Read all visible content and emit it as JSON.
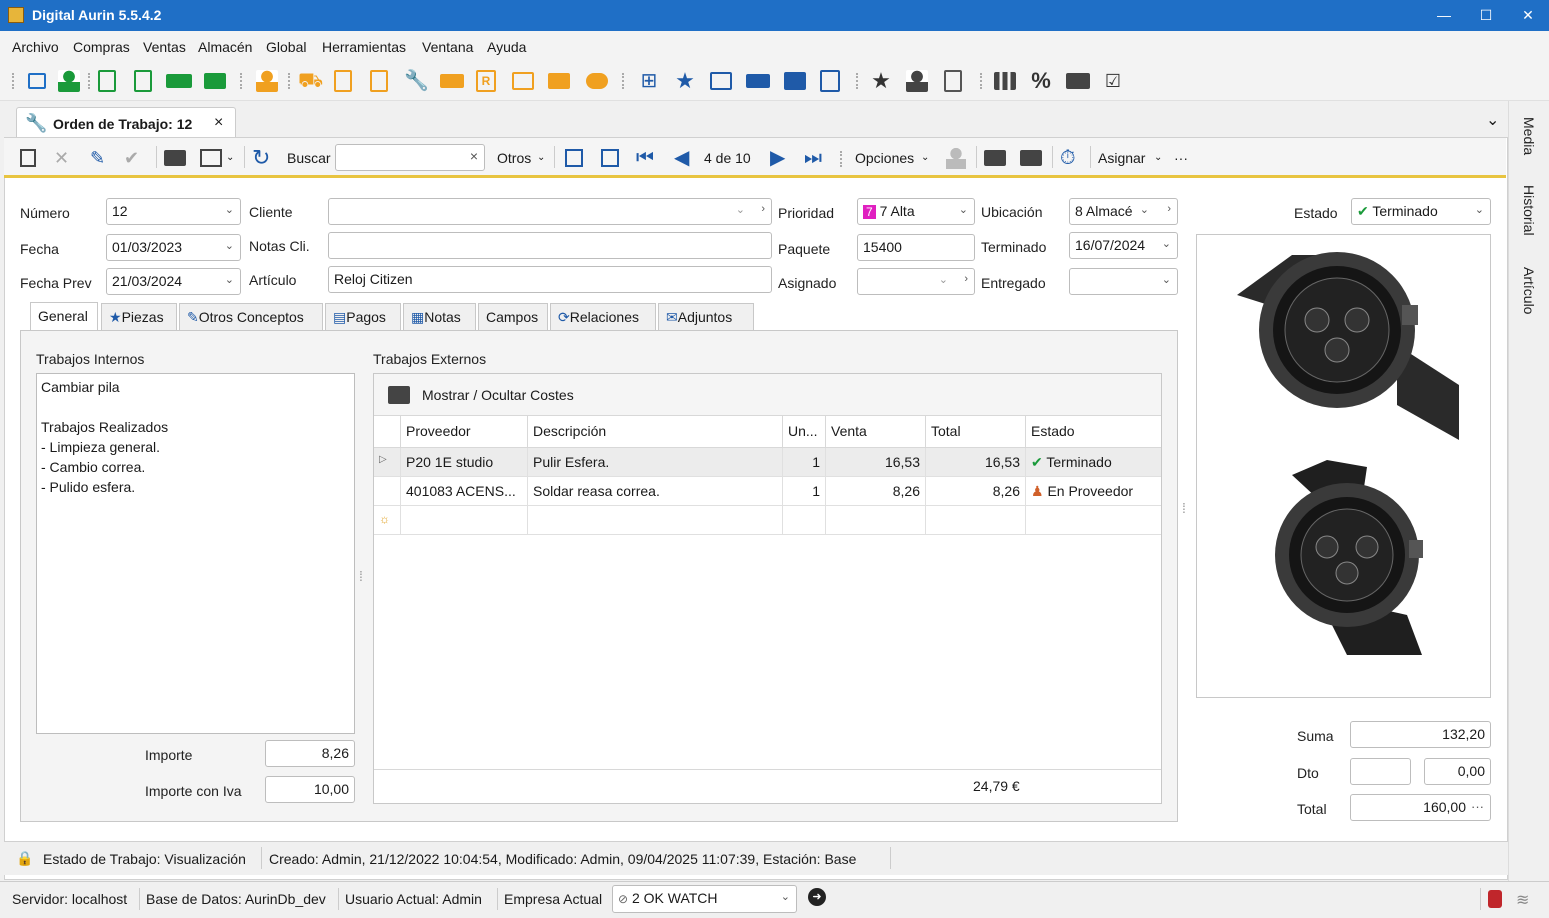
{
  "window": {
    "title": "Digital Aurin 5.5.4.2",
    "min": "—",
    "max": "☐",
    "close": "✕"
  },
  "menu": [
    "Archivo",
    "Compras",
    "Ventas",
    "Almacén",
    "Global",
    "Herramientas",
    "Ventana",
    "Ayuda"
  ],
  "doc_tab": {
    "label": "Orden de Trabajo: 12",
    "close": "×",
    "overflow": "⌄"
  },
  "side_tabs": [
    "Media",
    "Historial",
    "Artículo"
  ],
  "toolbar": {
    "buscar": "Buscar",
    "otros": "Otros",
    "pager": "4 de 10",
    "opciones": "Opciones",
    "asignar": "Asignar",
    "more": "···",
    "clear": "×"
  },
  "form": {
    "numero": {
      "label": "Número",
      "value": "12"
    },
    "fecha": {
      "label": "Fecha",
      "value": "01/03/2023"
    },
    "fecha_prev": {
      "label": "Fecha Prev",
      "value": "21/03/2024"
    },
    "cliente": {
      "label": "Cliente",
      "value": ""
    },
    "notas_cli": {
      "label": "Notas Cli.",
      "value": ""
    },
    "articulo": {
      "label": "Artículo",
      "value": "Reloj Citizen"
    },
    "prioridad": {
      "label": "Prioridad",
      "value": "7 Alta",
      "badge": "7",
      "badge_color": "#e020c0"
    },
    "paquete": {
      "label": "Paquete",
      "value": "15400"
    },
    "asignado": {
      "label": "Asignado",
      "value": ""
    },
    "ubicacion": {
      "label": "Ubicación",
      "value": "8 Almacé"
    },
    "terminado": {
      "label": "Terminado",
      "value": "16/07/2024"
    },
    "entregado": {
      "label": "Entregado",
      "value": ""
    },
    "estado": {
      "label": "Estado",
      "value": "Terminado"
    }
  },
  "inner_tabs": [
    "General",
    "Piezas",
    "Otros Conceptos",
    "Pagos",
    "Notas",
    "Campos",
    "Relaciones",
    "Adjuntos"
  ],
  "trabajos_internos": {
    "label": "Trabajos Internos",
    "text": "Cambiar pila\n\nTrabajos Realizados\n- Limpieza general.\n- Cambio correa.\n- Pulido esfera."
  },
  "importe": {
    "label": "Importe",
    "value": "8,26"
  },
  "importe_iva": {
    "label": "Importe con Iva",
    "value": "10,00"
  },
  "trabajos_externos": {
    "label": "Trabajos Externos",
    "toggle": "Mostrar / Ocultar Costes",
    "columns": [
      "Proveedor",
      "Descripción",
      "Un...",
      "Venta",
      "Total",
      "Estado"
    ],
    "rows": [
      {
        "proveedor": "P20  1E studio",
        "descripcion": "Pulir Esfera.",
        "un": "1",
        "venta": "16,53",
        "total": "16,53",
        "estado": "Terminado"
      },
      {
        "proveedor": "401083  ACENS...",
        "descripcion": "Soldar reasa correa.",
        "un": "1",
        "venta": "8,26",
        "total": "8,26",
        "estado": "En Proveedor"
      }
    ],
    "footer_total": "24,79 €"
  },
  "totals": {
    "suma_label": "Suma",
    "suma": "132,20",
    "dto_label": "Dto",
    "dto_pct": "",
    "dto": "0,00",
    "total_label": "Total",
    "total": "160,00",
    "more": "···"
  },
  "status": "Estado de Trabajo: Visualización",
  "audit": "Creado: Admin, 21/12/2022 10:04:54, Modificado: Admin, 09/04/2025 11:07:39, Estación: Base",
  "bottom": {
    "servidor": "Servidor: localhost",
    "bd": "Base de Datos: AurinDb_dev",
    "usuario": "Usuario Actual: Admin",
    "empresa_label": "Empresa Actual",
    "empresa": "2  OK WATCH"
  }
}
